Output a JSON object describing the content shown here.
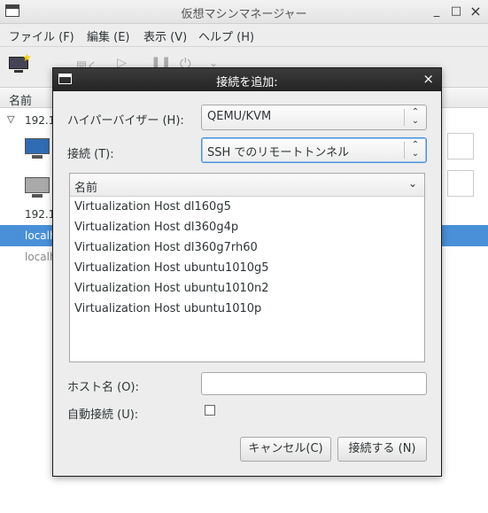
{
  "window": {
    "title": "仮想マシンマネージャー",
    "minimize": "_",
    "maximize": "□",
    "close": "×"
  },
  "menubar": [
    {
      "label": "ファイル (F)"
    },
    {
      "label": "編集 (E)"
    },
    {
      "label": "表示 (V)"
    },
    {
      "label": "ヘルプ (H)"
    }
  ],
  "toolbar": {
    "open_label": "開く"
  },
  "background_list": {
    "header": "名前",
    "group1": "192.1",
    "group2": "192.1",
    "item_selected": "localh",
    "item_other": "localh"
  },
  "dialog": {
    "title": "接続を追加:",
    "hypervisor_label": "ハイパーバイザー (H):",
    "hypervisor_value": "QEMU/KVM",
    "connection_label": "接続 (T):",
    "connection_value": "SSH でのリモートトンネル",
    "list_header": "名前",
    "hosts": [
      "Virtualization Host dl160g5",
      "Virtualization Host dl360g4p",
      "Virtualization Host dl360g7rh60",
      "Virtualization Host ubuntu1010g5",
      "Virtualization Host ubuntu1010n2",
      "Virtualization Host ubuntu1010p"
    ],
    "hostname_label": "ホスト名 (O):",
    "hostname_value": "",
    "autoconnect_label": "自動接続 (U):",
    "autoconnect_checked": false,
    "cancel_label": "キャンセル(C)",
    "connect_label": "接続する (N)"
  },
  "colors": {
    "selection": "#4a90d9",
    "dialog_title_bg": "#2b2b2b"
  }
}
